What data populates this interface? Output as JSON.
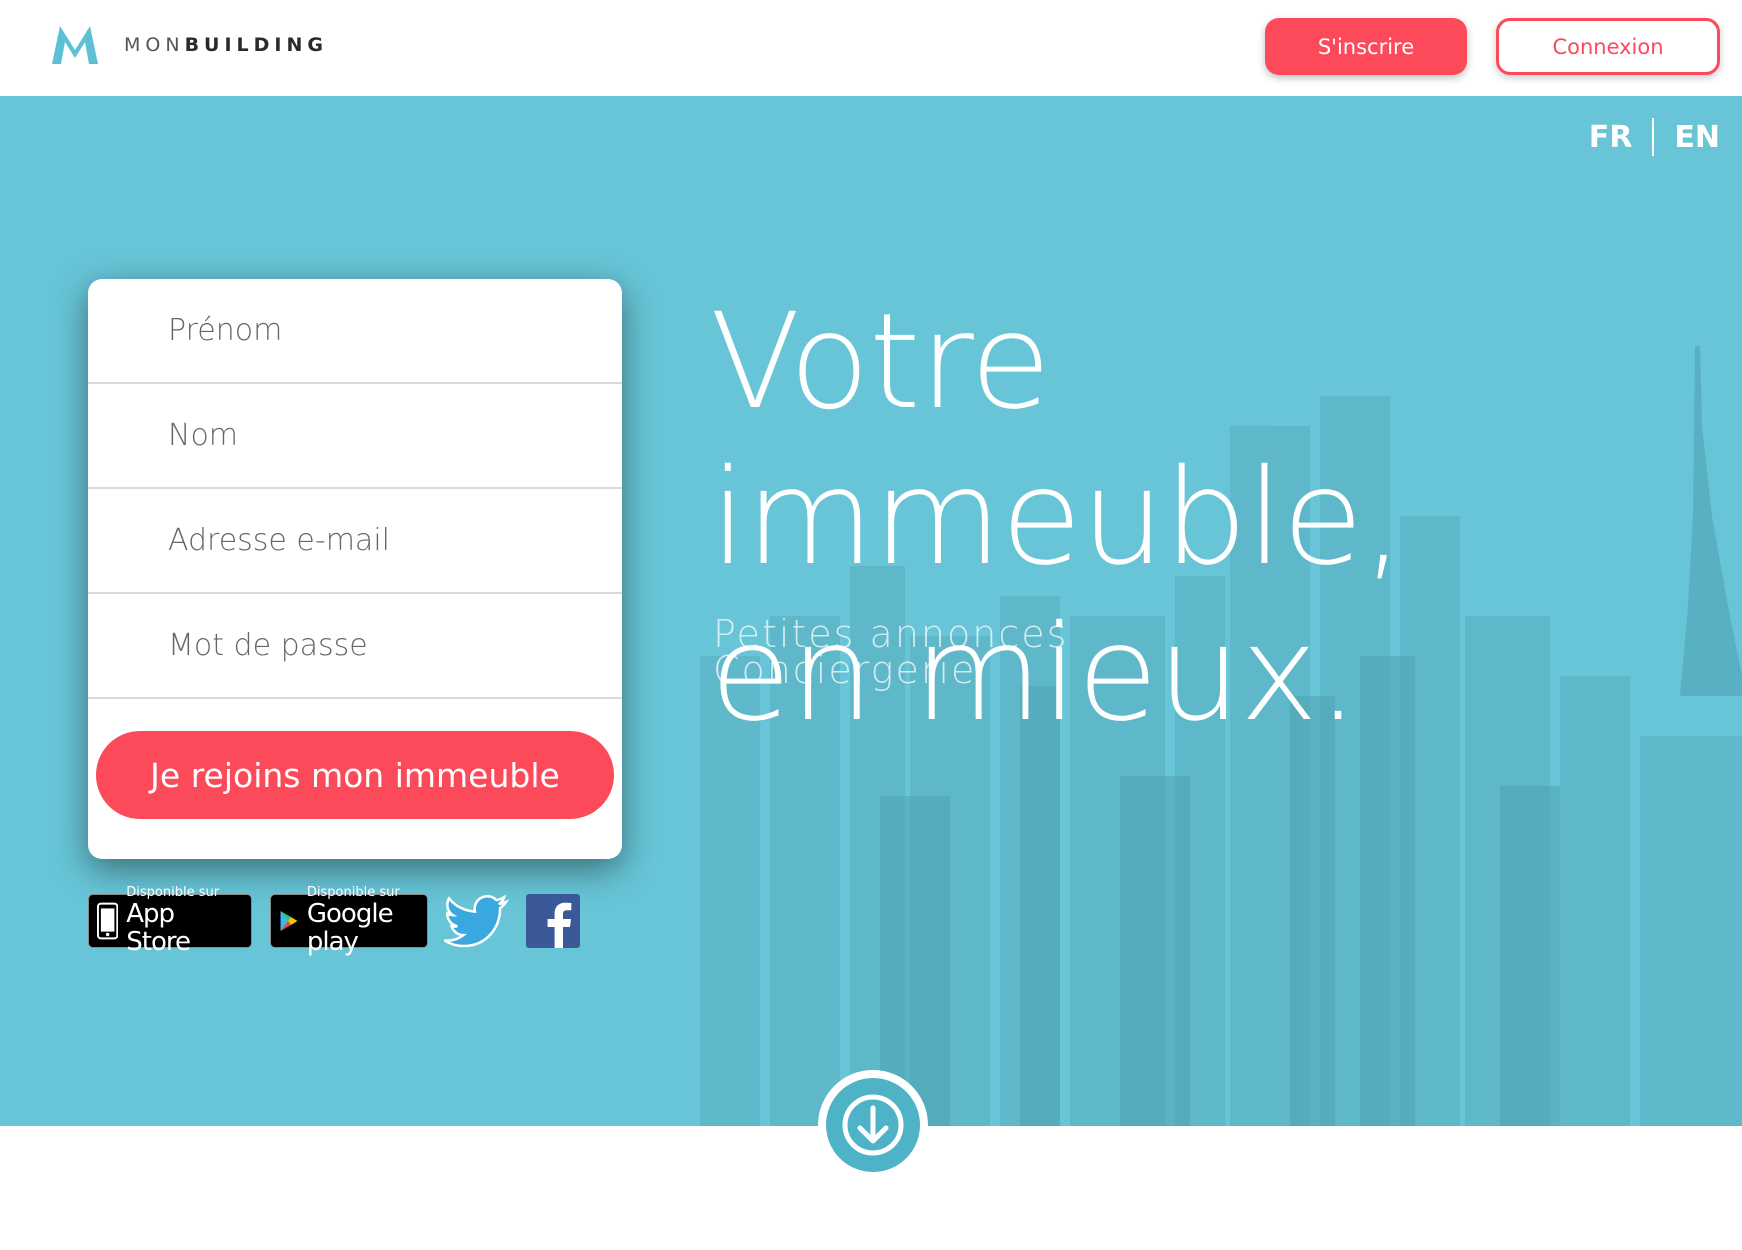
{
  "brand": {
    "logo_letter": "M",
    "name_light": "MON",
    "name_bold": "BUILDING",
    "accent_color": "#5ec1d3"
  },
  "header": {
    "signup_label": "S'inscrire",
    "login_label": "Connexion"
  },
  "language": {
    "fr": "FR",
    "en": "EN"
  },
  "hero": {
    "headline_line1": "Votre immeuble,",
    "headline_line2": "en mieux.",
    "features": [
      "Petites annonces",
      "Conciergerie"
    ],
    "background_color": "#67c5d7"
  },
  "form": {
    "first_name_placeholder": "Prénom",
    "last_name_placeholder": "Nom",
    "email_placeholder": "Adresse e-mail",
    "password_placeholder": "Mot de passe",
    "submit_label": "Je rejoins mon immeuble",
    "button_color": "#fc4a5a"
  },
  "badges": {
    "appstore_small": "Disponible sur",
    "appstore_big": "App Store",
    "googleplay_small": "Disponible sur",
    "googleplay_big": "Google play",
    "twitter_icon": "twitter-icon",
    "facebook_icon": "facebook-icon"
  },
  "scroll": {
    "icon": "arrow-down-icon"
  }
}
